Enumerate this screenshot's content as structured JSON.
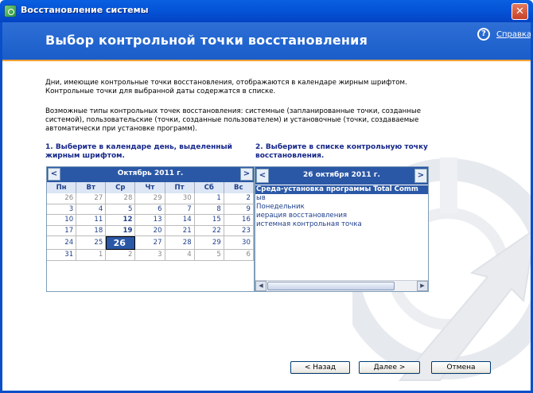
{
  "window": {
    "title": "Восстановление системы",
    "close_label": "✕"
  },
  "header": {
    "title": "Выбор контрольной точки восстановления",
    "help_icon": "?",
    "help_label": "Справка"
  },
  "intro": {
    "p1": "Дни, имеющие контрольные точки восстановления, отображаются в календаре жирным шрифтом. Контрольные точки для выбранной даты содержатся в списке.",
    "p2": "Возможные типы контрольных точек восстановления: системные (запланированные точки, созданные системой), пользовательские (точки, созданные пользователем) и установочные (точки, создаваемые автоматически при установке программ)."
  },
  "step1": {
    "label": "1. Выберите в календаре день, выделенный жирным шрифтом."
  },
  "step2": {
    "label": "2. Выберите в списке контрольную точку восстановления."
  },
  "calendar": {
    "title": "Октябрь 2011 г.",
    "prev": "<",
    "next": ">",
    "weekdays": [
      "Пн",
      "Вт",
      "Ср",
      "Чт",
      "Пт",
      "Сб",
      "Вс"
    ],
    "weeks": [
      [
        {
          "d": "26",
          "other": true
        },
        {
          "d": "27",
          "other": true
        },
        {
          "d": "28",
          "other": true
        },
        {
          "d": "29",
          "other": true
        },
        {
          "d": "30",
          "other": true
        },
        {
          "d": "1"
        },
        {
          "d": "2"
        }
      ],
      [
        {
          "d": "3"
        },
        {
          "d": "4"
        },
        {
          "d": "5"
        },
        {
          "d": "6"
        },
        {
          "d": "7"
        },
        {
          "d": "8"
        },
        {
          "d": "9"
        }
      ],
      [
        {
          "d": "10"
        },
        {
          "d": "11"
        },
        {
          "d": "12",
          "bold": true
        },
        {
          "d": "13"
        },
        {
          "d": "14"
        },
        {
          "d": "15"
        },
        {
          "d": "16"
        }
      ],
      [
        {
          "d": "17"
        },
        {
          "d": "18"
        },
        {
          "d": "19",
          "bold": true
        },
        {
          "d": "20"
        },
        {
          "d": "21"
        },
        {
          "d": "22"
        },
        {
          "d": "23"
        }
      ],
      [
        {
          "d": "24"
        },
        {
          "d": "25"
        },
        {
          "d": "26",
          "selected": true
        },
        {
          "d": "27"
        },
        {
          "d": "28"
        },
        {
          "d": "29"
        },
        {
          "d": "30"
        }
      ],
      [
        {
          "d": "31"
        },
        {
          "d": "1",
          "other": true
        },
        {
          "d": "2",
          "other": true
        },
        {
          "d": "3",
          "other": true
        },
        {
          "d": "4",
          "other": true
        },
        {
          "d": "5",
          "other": true
        },
        {
          "d": "6",
          "other": true
        }
      ]
    ]
  },
  "restore_list": {
    "title": "26 октября 2011 г.",
    "prev": "<",
    "next": ">",
    "items": [
      {
        "label": "Среда-установка программы Total Comm",
        "selected": true
      },
      {
        "label": "ыв"
      },
      {
        "label": "Понедельник"
      },
      {
        "label": "иерация восстановления"
      },
      {
        "label": "истемная контрольная точка"
      }
    ],
    "scroll_left": "◀",
    "scroll_right": "▶"
  },
  "buttons": {
    "back": "< Назад",
    "next": "Далее >",
    "cancel": "Отмена"
  },
  "colors": {
    "titlebar": "#0554d8",
    "header_band": "#2e6fd6",
    "header_accent": "#f3a33a",
    "step_text": "#15278a",
    "calendar_head": "#2b58a6"
  }
}
